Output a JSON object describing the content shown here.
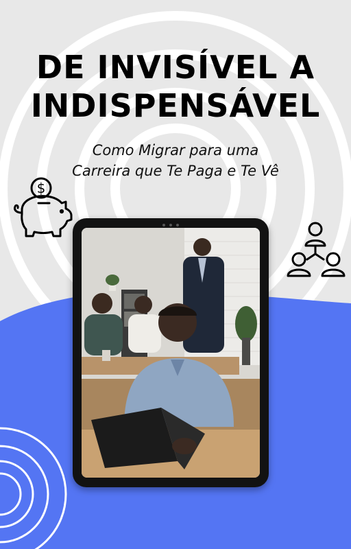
{
  "title": {
    "line1": "DE INVISÍVEL A",
    "line2": "INDISPENSÁVEL"
  },
  "subtitle": {
    "line1": "Como Migrar para uma",
    "line2": "Carreira que Te Paga e Te Vê"
  },
  "icons": {
    "left": "piggy-bank-with-dollar-coin-icon",
    "right": "people-network-icon"
  },
  "colors": {
    "background": "#e8e8e8",
    "accent_blue": "#5475f3",
    "ring_white": "#ffffff",
    "text": "#000000",
    "tablet_frame": "#121212"
  },
  "photo": {
    "description": "office-team-scene-photo"
  }
}
